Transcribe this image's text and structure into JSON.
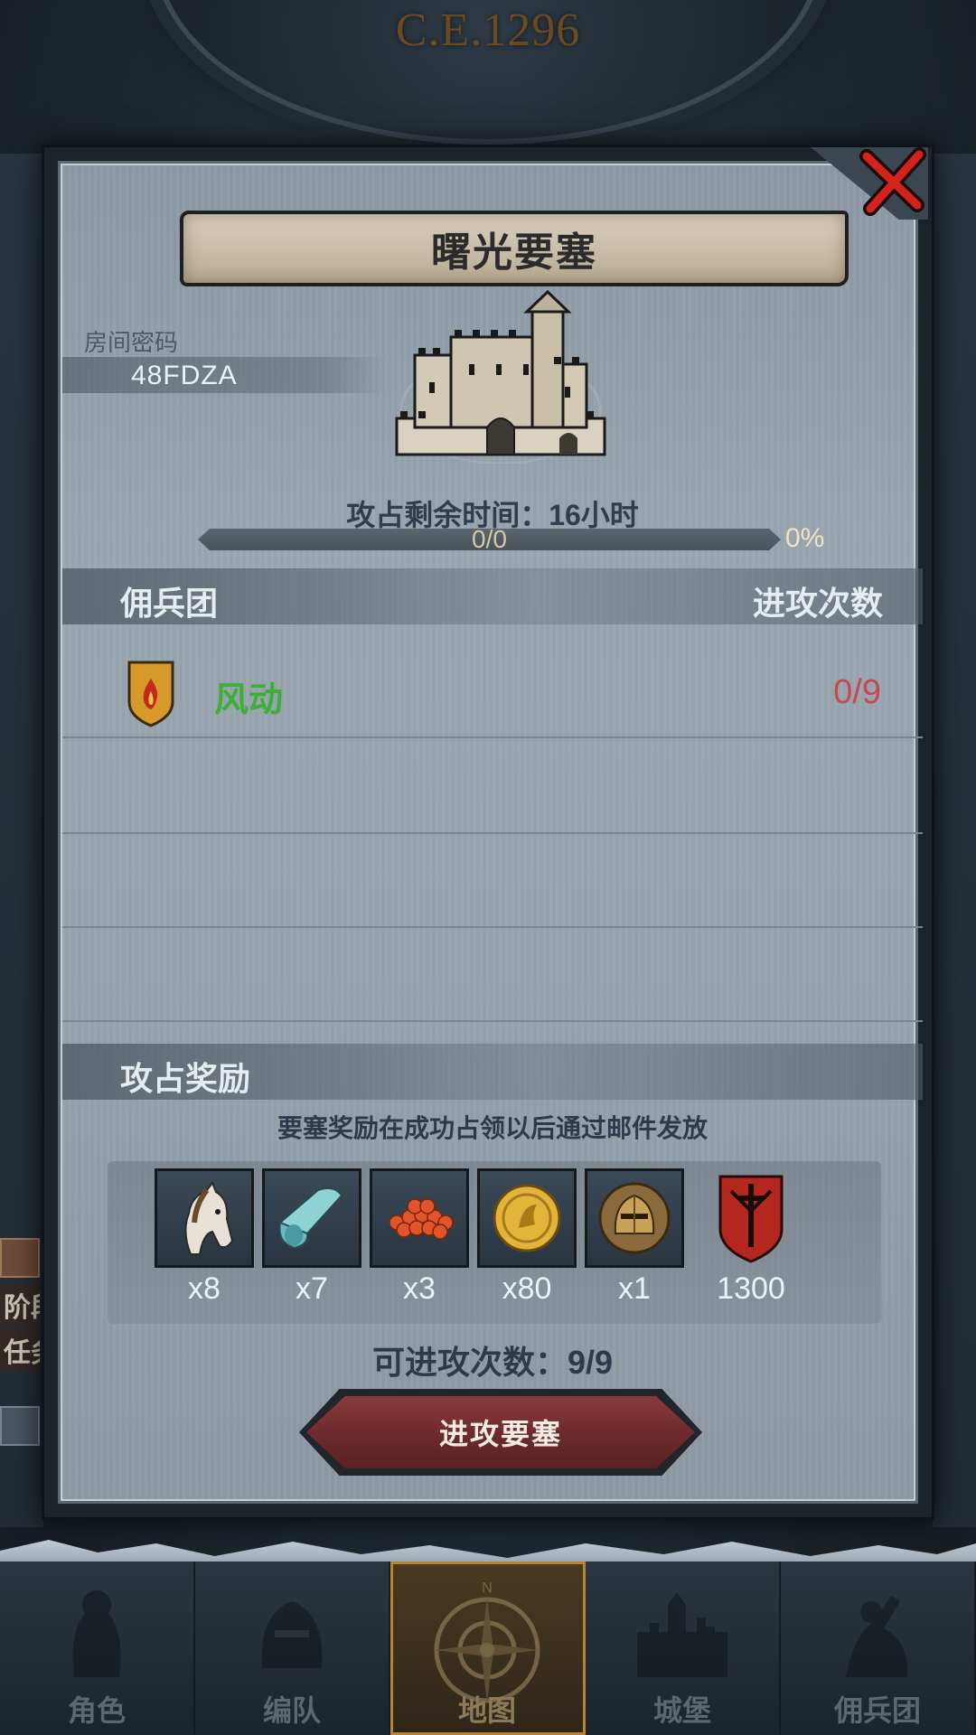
{
  "header": {
    "era": "C.E.1296"
  },
  "side": {
    "hint_line1": "阶段",
    "hint_line2": "任务"
  },
  "dialog": {
    "title": "曙光要塞",
    "room_label": "房间密码",
    "room_code": "48FDZA",
    "time_label": "攻占剩余时间：16小时",
    "progress": {
      "text": "0/0",
      "percent_text": "0%",
      "fraction": 0
    },
    "mercenary_header": "佣兵团",
    "attacks_header": "进攻次数",
    "mercenaries": [
      {
        "name": "风动",
        "count": "0/9",
        "color": "#3fae38"
      }
    ],
    "reward_header": "攻占奖励",
    "reward_note": "要塞奖励在成功占领以后通过邮件发放",
    "rewards": [
      {
        "icon": "horse-icon",
        "qty": "x8"
      },
      {
        "icon": "cloth-roll-icon",
        "qty": "x7"
      },
      {
        "icon": "red-beads-icon",
        "qty": "x3"
      },
      {
        "icon": "gold-coin-icon",
        "qty": "x80"
      },
      {
        "icon": "knight-helmet-icon",
        "qty": "x1"
      },
      {
        "icon": "sword-shield-icon",
        "qty": "1300"
      }
    ],
    "attempts_label": "可进攻次数：9/9",
    "attack_button": "进攻要塞"
  },
  "nav": {
    "tabs": [
      {
        "label": "角色",
        "icon": "knight-icon"
      },
      {
        "label": "编队",
        "icon": "helmet-icon"
      },
      {
        "label": "地图",
        "icon": "compass-icon",
        "active": true
      },
      {
        "label": "城堡",
        "icon": "castle-icon"
      },
      {
        "label": "佣兵团",
        "icon": "mercenary-icon"
      }
    ]
  },
  "colors": {
    "accent_green": "#3fae38",
    "count_red": "#c7484e",
    "button_red": "#7a3034",
    "active_tab_gold": "#b8842e"
  }
}
